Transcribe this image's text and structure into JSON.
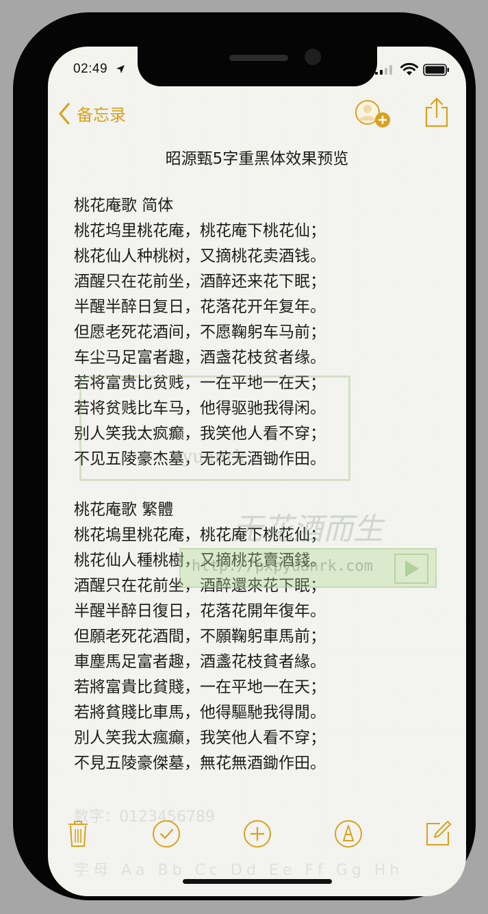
{
  "status_bar": {
    "time": "02:49"
  },
  "nav": {
    "back_label": "备忘录"
  },
  "note": {
    "title": "昭源甄5字重黑体效果预览",
    "sections": [
      {
        "heading": "桃花庵歌  简体",
        "lines": [
          "桃花坞里桃花庵，桃花庵下桃花仙；",
          "桃花仙人种桃树，又摘桃花卖酒钱。",
          "酒醒只在花前坐，酒醉还来花下眠；",
          "半醒半醉日复日，花落花开年复年。",
          "但愿老死花酒间，不愿鞠躬车马前；",
          "车尘马足富者趣，酒盏花枝贫者缘。",
          "若将富贵比贫贱，一在平地一在天；",
          "若将贫贱比车马，他得驱驰我得闲。",
          "别人笑我太疯癫，我笑他人看不穿；",
          "不见五陵豪杰墓，无花无酒锄作田。"
        ]
      },
      {
        "heading": "桃花庵歌  繁體",
        "lines": [
          "桃花塢里桃花庵，桃花庵下桃花仙；",
          "桃花仙人種桃樹，又摘桃花賣酒錢。",
          "酒醒只在花前坐，酒醉還來花下眠；",
          "半醒半醉日復日，花落花開年復年。",
          "但願老死花酒間，不願鞠躬車馬前；",
          "車塵馬足富者趣，酒盞花枝貧者緣。",
          "若將富貴比貧賤，一在平地一在天；",
          "若將貧賤比車馬，他得驅馳我得閒。",
          "別人笑我太瘋癲，我笑他人看不穿；",
          "不見五陵豪傑墓，無花無酒鋤作田。"
        ]
      }
    ]
  },
  "watermark": {
    "brand": "tyuanrk",
    "calligraphy": "无花酒而生",
    "url": "http://pxpyuanrk.com"
  },
  "faded_text": {
    "line1": "数字：0123456789",
    "line2": "字母 Aa  Bb  Cc  Dd  Ee  Ff  Gg  Hh"
  },
  "toolbar": {
    "icons": [
      "trash-icon",
      "checklist-icon",
      "add-icon",
      "markup-icon",
      "compose-icon"
    ]
  },
  "colors": {
    "accent": "#d8a21c",
    "text": "#1d1d1d",
    "paper": "#f4f4f0"
  }
}
